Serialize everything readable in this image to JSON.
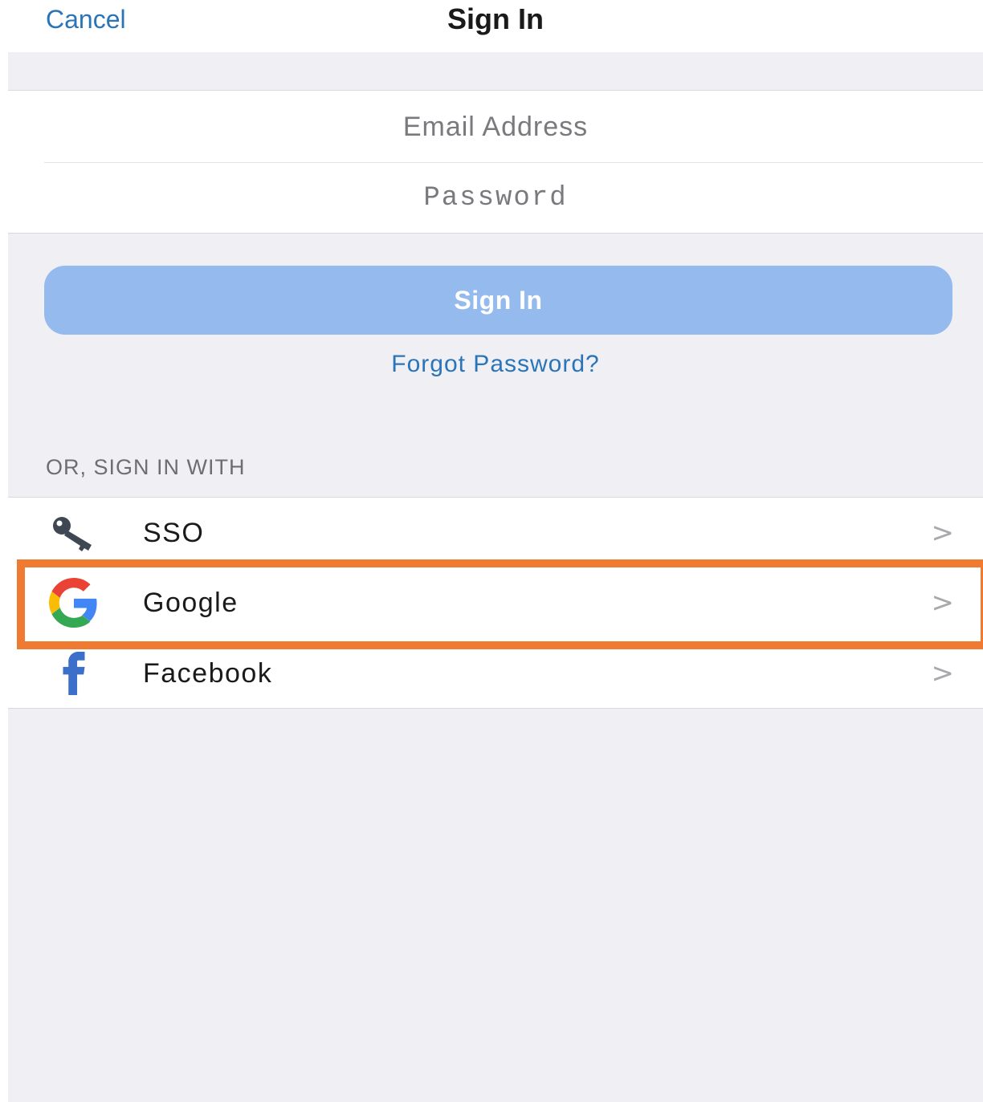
{
  "navbar": {
    "cancel_label": "Cancel",
    "title": "Sign In"
  },
  "form": {
    "email_placeholder": "Email Address",
    "password_placeholder": "Password",
    "signin_label": "Sign In",
    "forgot_label": "Forgot Password?"
  },
  "providers": {
    "section_header": "OR, SIGN IN WITH",
    "items": [
      {
        "label": "SSO",
        "icon": "key-icon"
      },
      {
        "label": "Google",
        "icon": "google-icon"
      },
      {
        "label": "Facebook",
        "icon": "facebook-icon"
      }
    ],
    "chevron": ">"
  },
  "colors": {
    "link_blue": "#2a75b8",
    "button_blue": "#95bbee",
    "highlight_orange": "#f07a32",
    "background_gray": "#efeff4",
    "facebook_blue": "#3b6fc9"
  }
}
